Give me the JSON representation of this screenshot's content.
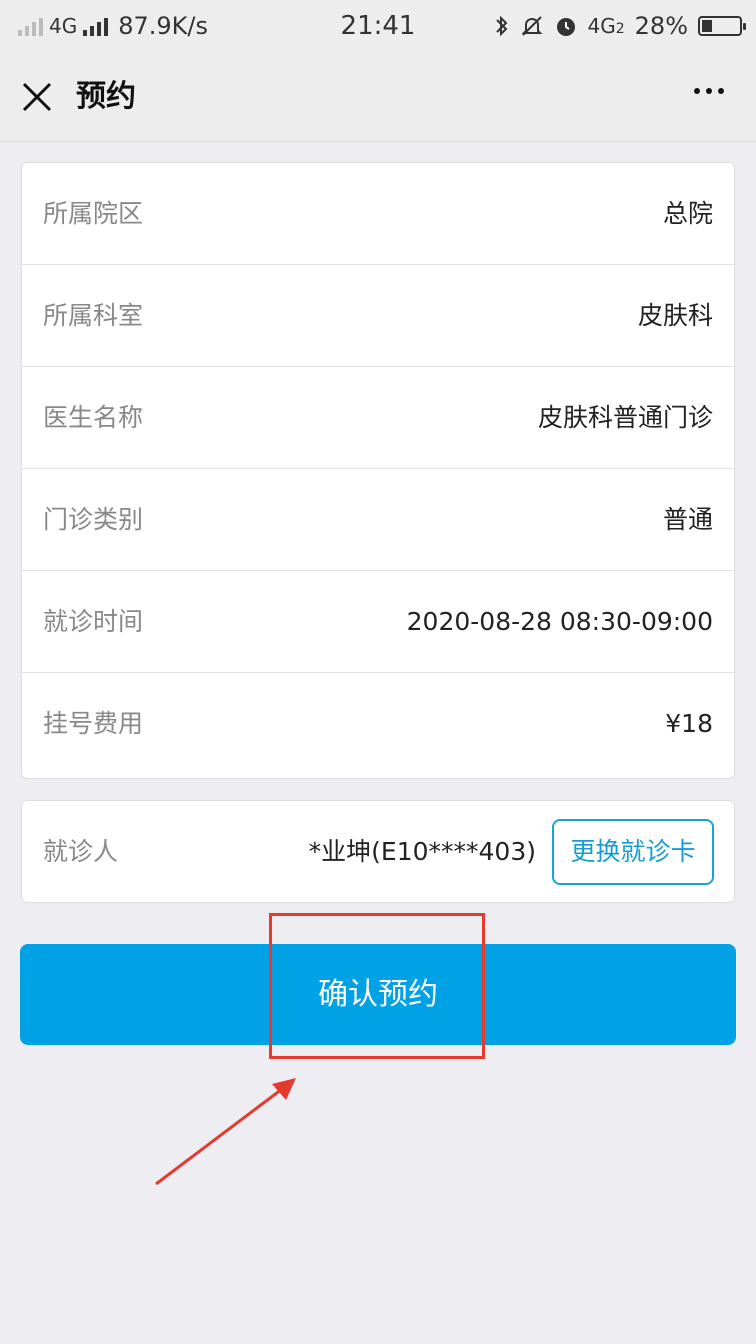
{
  "status_bar": {
    "network_left": "4G",
    "speed": "87.9K/s",
    "time": "21:41",
    "network_right": "4G",
    "network_right_sub": "2",
    "battery": "28%",
    "battery_level": 0.28,
    "icons": [
      "signal-icon",
      "signal-icon",
      "bluetooth-icon",
      "mute-bell-icon",
      "alarm-icon",
      "battery-icon"
    ]
  },
  "nav": {
    "title": "预约",
    "close_icon": "close-icon",
    "more_icon": "more-icon"
  },
  "info": {
    "rows": [
      {
        "label": "所属院区",
        "value": "总院"
      },
      {
        "label": "所属科室",
        "value": "皮肤科"
      },
      {
        "label": "医生名称",
        "value": "皮肤科普通门诊"
      },
      {
        "label": "门诊类别",
        "value": "普通"
      },
      {
        "label": "就诊时间",
        "value": "2020-08-28 08:30-09:00"
      },
      {
        "label": "挂号费用",
        "value": "¥18"
      }
    ]
  },
  "patient": {
    "label": "就诊人",
    "name": "*业坤(E10****403)",
    "change_button": "更换就诊卡"
  },
  "confirm_button": "确认预约",
  "colors": {
    "accent": "#00A2E5",
    "annotation": "#E53A2E",
    "background": "#EDEDF2"
  }
}
